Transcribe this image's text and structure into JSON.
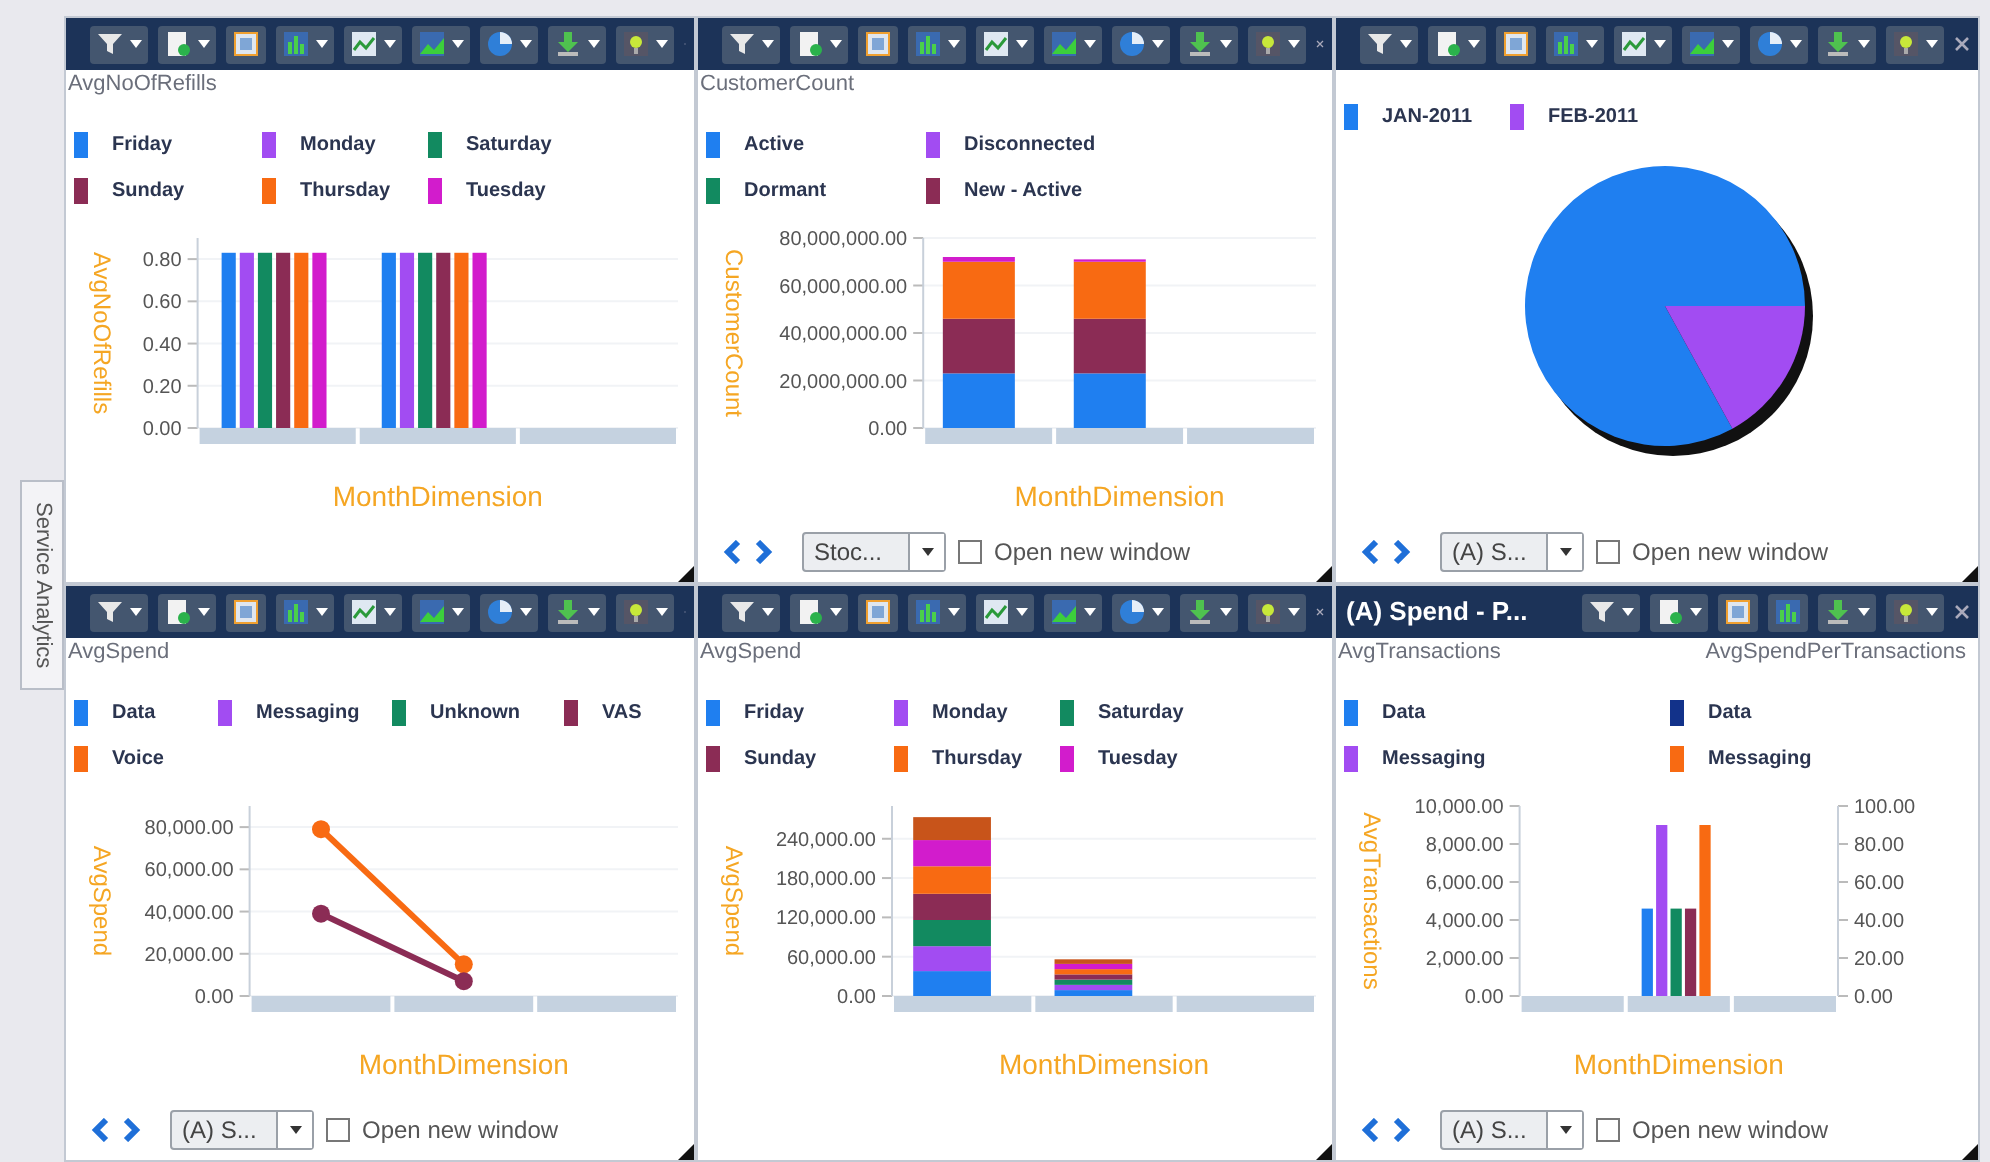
{
  "side_tab": {
    "label": "Service Analytics"
  },
  "panels": [
    {
      "toolbar": {
        "tools": [
          {
            "kind": "filter",
            "menu": true
          },
          {
            "kind": "page",
            "menu": true
          },
          {
            "kind": "frame",
            "menu": false
          },
          {
            "kind": "bar",
            "menu": true
          },
          {
            "kind": "line",
            "menu": true
          },
          {
            "kind": "area",
            "menu": true
          },
          {
            "kind": "globe",
            "menu": true
          },
          {
            "kind": "download",
            "menu": true
          },
          {
            "kind": "bulb",
            "menu": true
          }
        ]
      },
      "titles": [
        "AvgNoOfRefills"
      ],
      "legend": [
        {
          "label": "Friday",
          "color": "#1f7ff0"
        },
        {
          "label": "Monday",
          "color": "#a24cf2"
        },
        {
          "label": "Saturday",
          "color": "#128a60"
        },
        {
          "label": "Sunday",
          "color": "#8b2c55"
        },
        {
          "label": "Thursday",
          "color": "#f86a12"
        },
        {
          "label": "Tuesday",
          "color": "#d21ccc"
        }
      ],
      "chart_data": {
        "type": "bar",
        "grid": true,
        "ylabel": "AvgNoOfRefills",
        "xlabel": "MonthDimension",
        "ylim": [
          0,
          0.9
        ],
        "yticks": [
          {
            "value": 0,
            "label": "0.00"
          },
          {
            "value": 0.2,
            "label": "0.20"
          },
          {
            "value": 0.4,
            "label": "0.40"
          },
          {
            "value": 0.6,
            "label": "0.60"
          },
          {
            "value": 0.8,
            "label": "0.80"
          }
        ],
        "series": [
          {
            "color": "#1f7ff0",
            "values": [
              0.83,
              0.83,
              null
            ]
          },
          {
            "color": "#a24cf2",
            "values": [
              0.83,
              0.83,
              null
            ]
          },
          {
            "color": "#128a60",
            "values": [
              0.83,
              0.83,
              null
            ]
          },
          {
            "color": "#8b2c55",
            "values": [
              0.83,
              0.83,
              null
            ]
          },
          {
            "color": "#f86a12",
            "values": [
              0.83,
              0.83,
              null
            ]
          },
          {
            "color": "#d21ccc",
            "values": [
              0.83,
              0.83,
              null
            ]
          }
        ]
      }
    },
    {
      "toolbar": {
        "tools": [
          {
            "kind": "filter",
            "menu": true
          },
          {
            "kind": "page",
            "menu": true
          },
          {
            "kind": "frame",
            "menu": false
          },
          {
            "kind": "bar",
            "menu": true
          },
          {
            "kind": "line",
            "menu": true
          },
          {
            "kind": "area",
            "menu": true
          },
          {
            "kind": "globe",
            "menu": true
          },
          {
            "kind": "download",
            "menu": true
          },
          {
            "kind": "bulb",
            "menu": true
          }
        ]
      },
      "titles": [
        "CustomerCount"
      ],
      "legend": [
        {
          "label": "Active",
          "color": "#1f7ff0"
        },
        {
          "label": "Disconnected",
          "color": "#a24cf2"
        },
        {
          "label": "Dormant",
          "color": "#128a60"
        },
        {
          "label": "New - Active",
          "color": "#8b2c55"
        }
      ],
      "chart_data": {
        "type": "bar",
        "grid": true,
        "stacked": true,
        "ylabel": "CustomerCount",
        "xlabel": "MonthDimension",
        "ylim": [
          0,
          80000000
        ],
        "yticks": [
          {
            "value": 0,
            "label": "0.00"
          },
          {
            "value": 20000000,
            "label": "20,000,000.00"
          },
          {
            "value": 40000000,
            "label": "40,000,000.00"
          },
          {
            "value": 60000000,
            "label": "60,000,000.00"
          },
          {
            "value": 80000000,
            "label": "80,000,000.00"
          }
        ],
        "series": [
          {
            "color": "#1f7ff0",
            "values": [
              23000000,
              23000000,
              null
            ]
          },
          {
            "color": "#8b2c55",
            "values": [
              23000000,
              23000000,
              null
            ]
          },
          {
            "color": "#f86a12",
            "values": [
              24000000,
              24000000,
              null
            ]
          },
          {
            "color": "#d21ccc",
            "values": [
              2000000,
              1000000,
              null
            ]
          }
        ]
      },
      "footer": {
        "dropdown": "Stoc...",
        "checkbox": {
          "label": "Open new window",
          "checked": false
        }
      }
    },
    {
      "toolbar": {
        "tools": [
          {
            "kind": "filter",
            "menu": true
          },
          {
            "kind": "page",
            "menu": true
          },
          {
            "kind": "frame",
            "menu": false
          },
          {
            "kind": "bar",
            "menu": true
          },
          {
            "kind": "line",
            "menu": true
          },
          {
            "kind": "area",
            "menu": true
          },
          {
            "kind": "globe",
            "menu": true
          },
          {
            "kind": "download",
            "menu": true
          },
          {
            "kind": "bulb",
            "menu": true
          }
        ]
      },
      "legend": [
        {
          "label": "JAN-2011",
          "color": "#1f7ff0"
        },
        {
          "label": "FEB-2011",
          "color": "#a24cf2"
        }
      ],
      "chart_data": {
        "type": "pie",
        "series": [
          {
            "values": [
              0.83,
              0.17
            ]
          }
        ],
        "colors": [
          "#1f7ff0",
          "#a24cf2"
        ]
      },
      "footer": {
        "dropdown": "(A) S...",
        "checkbox": {
          "label": "Open new window",
          "checked": false
        }
      }
    },
    {
      "toolbar": {
        "tools": [
          {
            "kind": "filter",
            "menu": true
          },
          {
            "kind": "page",
            "menu": true
          },
          {
            "kind": "frame",
            "menu": false
          },
          {
            "kind": "bar",
            "menu": true
          },
          {
            "kind": "line",
            "menu": true
          },
          {
            "kind": "area",
            "menu": true
          },
          {
            "kind": "globe",
            "menu": true
          },
          {
            "kind": "download",
            "menu": true
          },
          {
            "kind": "bulb",
            "menu": true
          }
        ]
      },
      "titles": [
        "AvgSpend"
      ],
      "legend": [
        {
          "label": "Data",
          "color": "#1f7ff0"
        },
        {
          "label": "Messaging",
          "color": "#a24cf2"
        },
        {
          "label": "Unknown",
          "color": "#128a60"
        },
        {
          "label": "VAS",
          "color": "#8b2c55"
        },
        {
          "label": "Voice",
          "color": "#f86a12"
        }
      ],
      "chart_data": {
        "type": "line",
        "grid": true,
        "ylabel": "AvgSpend",
        "xlabel": "MonthDimension",
        "ylim": [
          0,
          90000
        ],
        "yticks": [
          {
            "value": 0,
            "label": "0.00"
          },
          {
            "value": 20000,
            "label": "20,000.00"
          },
          {
            "value": 40000,
            "label": "40,000.00"
          },
          {
            "value": 60000,
            "label": "60,000.00"
          },
          {
            "value": 80000,
            "label": "80,000.00"
          }
        ],
        "series": [
          {
            "color": "#f86a12",
            "marker": true,
            "values": [
              79000,
              15000,
              null
            ]
          },
          {
            "color": "#8b2c55",
            "marker": true,
            "values": [
              39000,
              7000,
              null
            ]
          }
        ]
      },
      "footer": {
        "dropdown": "(A) S...",
        "checkbox": {
          "label": "Open new window",
          "checked": false
        }
      }
    },
    {
      "toolbar": {
        "tools": [
          {
            "kind": "filter",
            "menu": true
          },
          {
            "kind": "page",
            "menu": true
          },
          {
            "kind": "frame",
            "menu": false
          },
          {
            "kind": "bar",
            "menu": true
          },
          {
            "kind": "line",
            "menu": true
          },
          {
            "kind": "area",
            "menu": true
          },
          {
            "kind": "globe",
            "menu": true
          },
          {
            "kind": "download",
            "menu": true
          },
          {
            "kind": "bulb",
            "menu": true
          }
        ]
      },
      "titles": [
        "AvgSpend"
      ],
      "legend": [
        {
          "label": "Friday",
          "color": "#1f7ff0"
        },
        {
          "label": "Monday",
          "color": "#a24cf2"
        },
        {
          "label": "Saturday",
          "color": "#128a60"
        },
        {
          "label": "Sunday",
          "color": "#8b2c55"
        },
        {
          "label": "Thursday",
          "color": "#f86a12"
        },
        {
          "label": "Tuesday",
          "color": "#d21ccc"
        }
      ],
      "chart_data": {
        "type": "bar",
        "grid": true,
        "stacked": true,
        "ylabel": "AvgSpend",
        "xlabel": "MonthDimension",
        "ylim": [
          0,
          290000
        ],
        "yticks": [
          {
            "value": 0,
            "label": "0.00"
          },
          {
            "value": 60000,
            "label": "60,000.00"
          },
          {
            "value": 120000,
            "label": "120,000.00"
          },
          {
            "value": 180000,
            "label": "180,000.00"
          },
          {
            "value": 240000,
            "label": "240,000.00"
          }
        ],
        "series": [
          {
            "color": "#1f7ff0",
            "values": [
              38000,
              9000,
              null
            ]
          },
          {
            "color": "#a24cf2",
            "values": [
              38000,
              8000,
              null
            ]
          },
          {
            "color": "#128a60",
            "values": [
              40000,
              8000,
              null
            ]
          },
          {
            "color": "#8b2c55",
            "values": [
              40000,
              8000,
              null
            ]
          },
          {
            "color": "#f86a12",
            "values": [
              42000,
              8000,
              null
            ]
          },
          {
            "color": "#d21ccc",
            "values": [
              40000,
              8000,
              null
            ]
          },
          {
            "color": "#c8541a",
            "values": [
              35000,
              7000,
              null
            ]
          }
        ]
      }
    },
    {
      "toolbar": {
        "title": "(A) Spend - P...",
        "tools": [
          {
            "kind": "filter",
            "menu": true
          },
          {
            "kind": "page",
            "menu": true
          },
          {
            "kind": "frame",
            "menu": false
          },
          {
            "kind": "bar",
            "menu": false
          },
          {
            "kind": "download",
            "menu": true
          },
          {
            "kind": "bulb",
            "menu": true
          }
        ]
      },
      "titles": [
        "AvgTransactions",
        "AvgSpendPerTransactions"
      ],
      "legend": [
        {
          "label": "Data",
          "color": "#1f7ff0"
        },
        {
          "label": "Data",
          "color": "#12328a"
        },
        {
          "label": "Messaging",
          "color": "#a24cf2"
        },
        {
          "label": "Messaging",
          "color": "#f86a12"
        }
      ],
      "chart_data": {
        "type": "bar",
        "categories": [
          null
        ],
        "ylabel": "AvgTransactions",
        "xlabel": "MonthDimension",
        "ylim": [
          0,
          10000
        ],
        "yticks": [
          {
            "value": 0,
            "label": "0.00"
          },
          {
            "value": 2000,
            "label": "2,000.00"
          },
          {
            "value": 4000,
            "label": "4,000.00"
          },
          {
            "value": 6000,
            "label": "6,000.00"
          },
          {
            "value": 8000,
            "label": "8,000.00"
          },
          {
            "value": 10000,
            "label": "10,000.00"
          }
        ],
        "series": [
          {
            "color": "#1f7ff0",
            "values": [
              4600
            ]
          },
          {
            "color": "#a24cf2",
            "values": [
              9000
            ]
          },
          {
            "color": "#128a60",
            "values": [
              4600
            ]
          },
          {
            "color": "#8b2c55",
            "values": [
              4600
            ]
          },
          {
            "color": "#f86a12",
            "values": [
              9000
            ]
          }
        ]
      },
      "right_axis": {
        "ticks": [
          "100.00",
          "80.00",
          "60.00",
          "40.00",
          "20.00",
          "0.00"
        ]
      },
      "footer": {
        "dropdown": "(A) S...",
        "checkbox": {
          "label": "Open new window",
          "checked": false
        }
      }
    }
  ]
}
